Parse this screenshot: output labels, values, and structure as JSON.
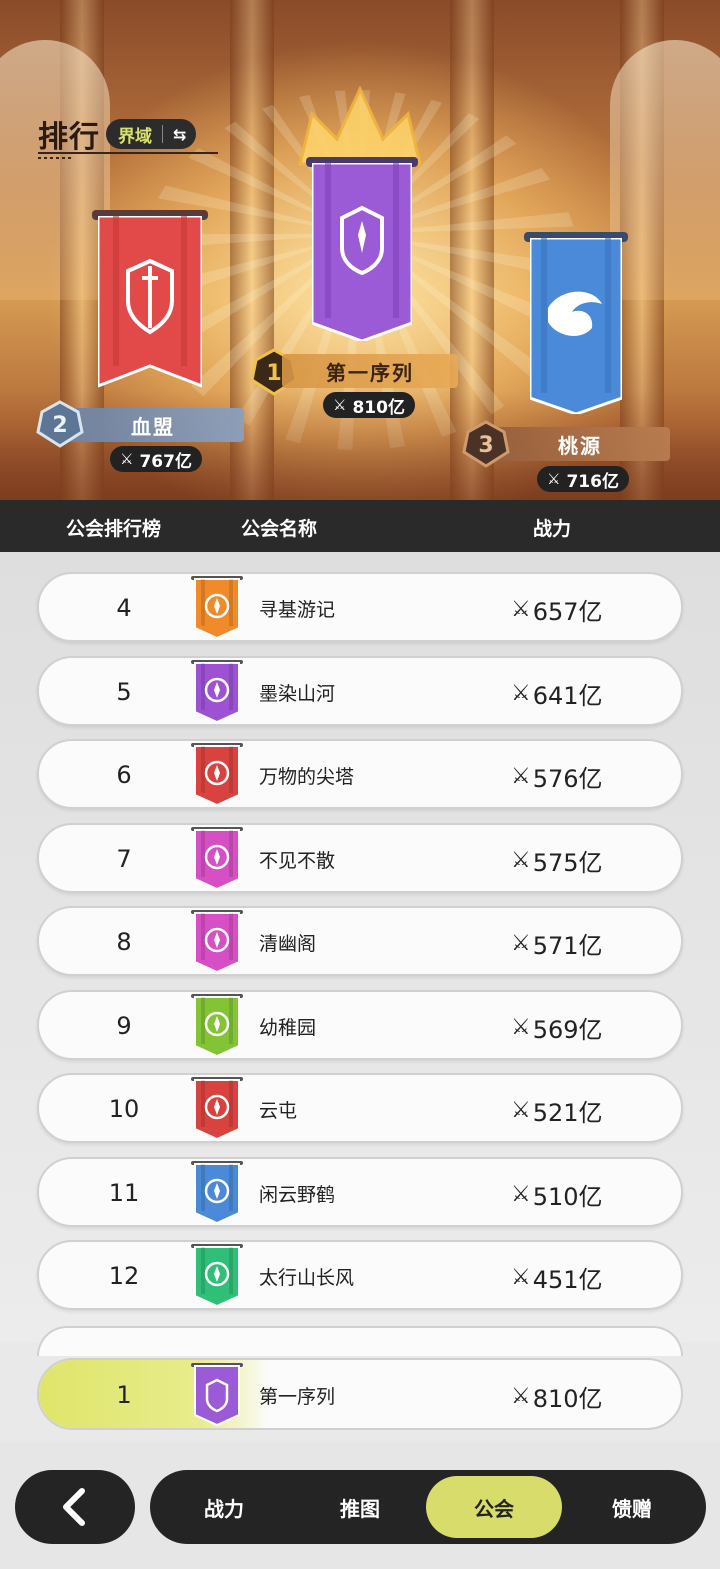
{
  "header": {
    "title": "排行",
    "realm_label": "界域",
    "swap_icon": "swap-arrows-icon"
  },
  "podium": {
    "first": {
      "rank": "1",
      "name": "第一序列",
      "power": "810亿",
      "color": "#9b5ad6"
    },
    "second": {
      "rank": "2",
      "name": "血盟",
      "power": "767亿",
      "color": "#e24a4a"
    },
    "third": {
      "rank": "3",
      "name": "桃源",
      "power": "716亿",
      "color": "#4a8ad8"
    }
  },
  "table": {
    "col_rank": "公会排行榜",
    "col_name": "公会名称",
    "col_power": "战力"
  },
  "rows": [
    {
      "rank": "4",
      "name": "寻基游记",
      "power": "657亿",
      "color": "#f08a2a"
    },
    {
      "rank": "5",
      "name": "墨染山河",
      "power": "641亿",
      "color": "#9c52d3"
    },
    {
      "rank": "6",
      "name": "万物的尖塔",
      "power": "576亿",
      "color": "#d8433f"
    },
    {
      "rank": "7",
      "name": "不见不散",
      "power": "575亿",
      "color": "#d64fc4"
    },
    {
      "rank": "8",
      "name": "清幽阁",
      "power": "571亿",
      "color": "#d64fc4"
    },
    {
      "rank": "9",
      "name": "幼稚园",
      "power": "569亿",
      "color": "#82c435"
    },
    {
      "rank": "10",
      "name": "云屯",
      "power": "521亿",
      "color": "#d8433f"
    },
    {
      "rank": "11",
      "name": "闲云野鹤",
      "power": "510亿",
      "color": "#4a8ad8"
    },
    {
      "rank": "12",
      "name": "太行山长风",
      "power": "451亿",
      "color": "#2fbf77"
    }
  ],
  "my_guild": {
    "rank": "1",
    "name": "第一序列",
    "power": "810亿",
    "color": "#9b5ad6"
  },
  "nav": {
    "back_icon": "chevron-left-icon",
    "tabs": [
      "战力",
      "推图",
      "公会",
      "馈赠"
    ],
    "active": "公会"
  },
  "power_icon": "crossed-swords-icon"
}
